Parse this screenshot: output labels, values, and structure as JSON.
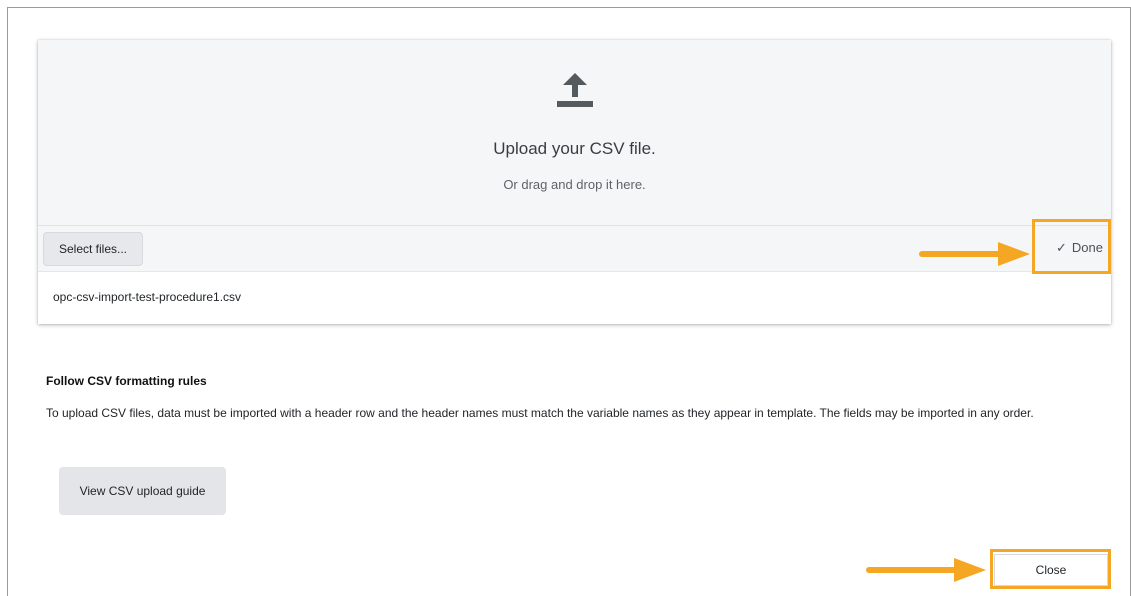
{
  "upload": {
    "title": "Upload your CSV file.",
    "subtitle": "Or drag and drop it here.",
    "select_files_label": "Select files...",
    "done_label": "Done",
    "file_name": "opc-csv-import-test-procedure1.csv"
  },
  "rules": {
    "heading": "Follow CSV formatting rules",
    "text": "To upload CSV files, data must be imported with a header row and the header names must match the variable names as they appear in template. The fields may be imported in any order.",
    "guide_button_label": "View CSV upload guide"
  },
  "footer": {
    "close_label": "Close"
  },
  "icons": {
    "upload": "upload-icon",
    "done": "check-icon"
  },
  "colors": {
    "highlight": "#f5a623",
    "icon": "#555a5f"
  }
}
